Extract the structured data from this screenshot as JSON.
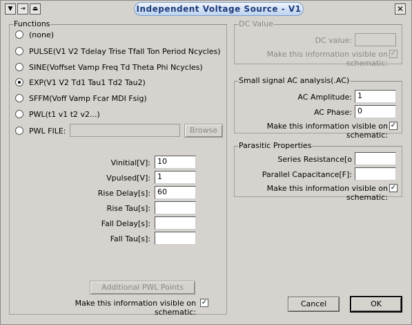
{
  "window": {
    "title": "Independent Voltage Source - V1",
    "close_glyph": "✕",
    "title_buttons": [
      "▼",
      "⇥",
      "⏏"
    ]
  },
  "functions": {
    "group_label": "Functions",
    "options": [
      {
        "label": "(none)",
        "checked": false
      },
      {
        "label": "PULSE(V1 V2 Tdelay Trise Tfall Ton Period Ncycles)",
        "checked": false
      },
      {
        "label": "SINE(Voffset Vamp Freq Td Theta Phi Ncycles)",
        "checked": false
      },
      {
        "label": "EXP(V1 V2 Td1 Tau1 Td2 Tau2)",
        "checked": true
      },
      {
        "label": "SFFM(Voff Vamp Fcar MDI Fsig)",
        "checked": false
      },
      {
        "label": "PWL(t1 v1 t2 v2...)",
        "checked": false
      },
      {
        "label": "PWL FILE:",
        "checked": false
      }
    ],
    "pwl_file_value": "",
    "browse_label": "Browse",
    "params": [
      {
        "label": "Vinitial[V]:",
        "value": "10"
      },
      {
        "label": "Vpulsed[V]:",
        "value": "1"
      },
      {
        "label": "Rise Delay[s]:",
        "value": "60"
      },
      {
        "label": "Rise Tau[s]:",
        "value": ""
      },
      {
        "label": "Fall Delay[s]:",
        "value": ""
      },
      {
        "label": "Fall Tau[s]:",
        "value": ""
      }
    ],
    "additional_pwl_label": "Additional PWL Points",
    "visible_label": "Make this information visible on schematic:",
    "visible_checked": "✓"
  },
  "dc_value": {
    "group_label": "DC Value",
    "value_label": "DC value:",
    "value": "",
    "visible_label": "Make this information visible on schematic:",
    "visible_checked": "✓"
  },
  "ac": {
    "group_label": "Small signal AC analysis(.AC)",
    "amplitude_label": "AC Amplitude:",
    "amplitude_value": "1",
    "phase_label": "AC Phase:",
    "phase_value": "0",
    "visible_label": "Make this information visible on schematic:",
    "visible_checked": "✓"
  },
  "parasitic": {
    "group_label": "Parasitic Properties",
    "series_label": "Series Resistance[o",
    "series_value": "",
    "parallel_label": "Parallel Capacitance[F]:",
    "parallel_value": "",
    "visible_label": "Make this information visible on schematic:",
    "visible_checked": "✓"
  },
  "buttons": {
    "cancel": "Cancel",
    "ok": "OK"
  },
  "colors": {
    "window_bg": "#d6d3ce",
    "title_text": "#1e3a7a",
    "disabled_text": "#8a8884"
  }
}
